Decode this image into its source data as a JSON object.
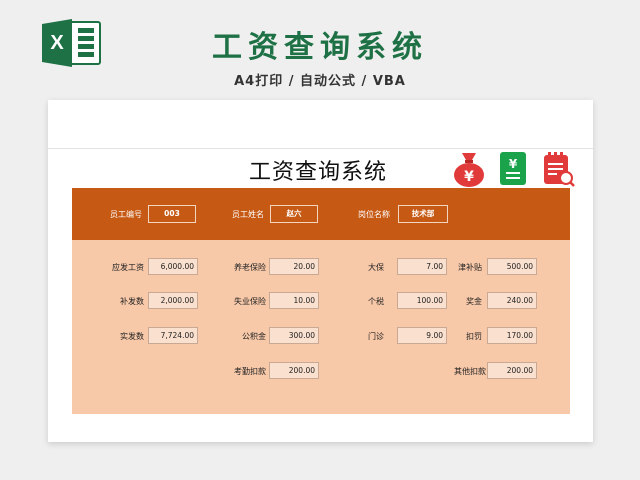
{
  "banner": {
    "title": "工资查询系统",
    "subtitle": "A4打印 / 自动公式 / VBA",
    "excel_icon": "excel-logo-icon"
  },
  "sheet": {
    "title": "工资查询系统",
    "icons": [
      "money-bag-icon",
      "receipt-icon",
      "calendar-search-icon"
    ],
    "colors": {
      "band": "#c65a15",
      "panel": "#f8c9a9",
      "green": "#1d7145",
      "red": "#e03a3a"
    }
  },
  "header": {
    "emp_id_label": "员工编号",
    "emp_id_value": "003",
    "emp_name_label": "员工姓名",
    "emp_name_value": "赵六",
    "position_label": "岗位名称",
    "position_value": "技术部"
  },
  "fields": {
    "gross_pay": {
      "label": "应发工资",
      "value": "6,000.00"
    },
    "pension": {
      "label": "养老保险",
      "value": "20.00"
    },
    "medical": {
      "label": "大保",
      "value": "7.00"
    },
    "allowance": {
      "label": "津补贴",
      "value": "500.00"
    },
    "back_pay": {
      "label": "补发数",
      "value": "2,000.00"
    },
    "unemployment": {
      "label": "失业保险",
      "value": "10.00"
    },
    "income_tax": {
      "label": "个税",
      "value": "100.00"
    },
    "bonus": {
      "label": "奖金",
      "value": "240.00"
    },
    "net_pay": {
      "label": "实发数",
      "value": "7,724.00"
    },
    "housing_fund": {
      "label": "公积金",
      "value": "300.00"
    },
    "clinic": {
      "label": "门诊",
      "value": "9.00"
    },
    "penalty": {
      "label": "扣罚",
      "value": "170.00"
    },
    "attendance": {
      "label": "考勤扣款",
      "value": "200.00"
    },
    "other": {
      "label": "其他扣款",
      "value": "200.00"
    }
  }
}
